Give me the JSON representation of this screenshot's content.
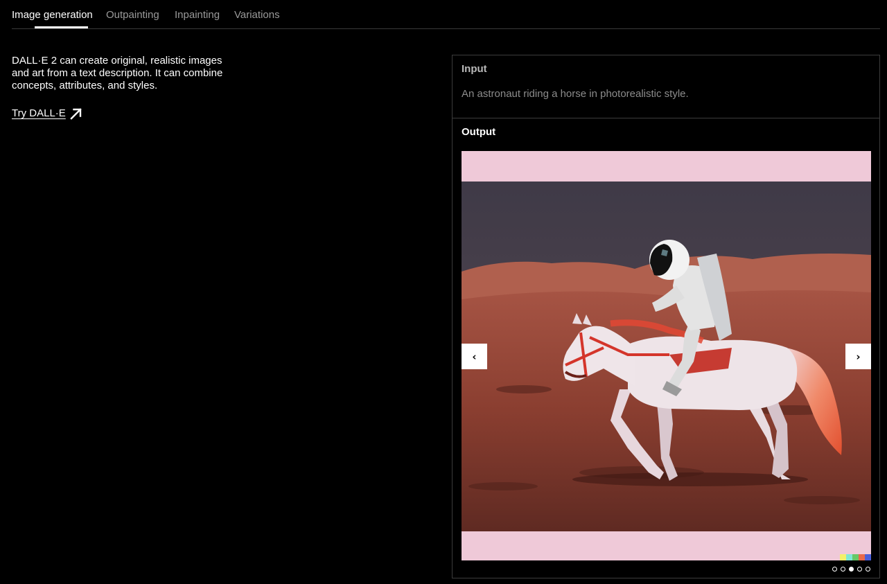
{
  "tabs": [
    {
      "label": "Image generation",
      "active": true
    },
    {
      "label": "Outpainting",
      "active": false
    },
    {
      "label": "Inpainting",
      "active": false
    },
    {
      "label": "Variations",
      "active": false
    }
  ],
  "intro": {
    "text": "DALL·E 2 can create original, realistic images and art from a text description. It can combine concepts, attributes, and styles.",
    "link_label": "Try DALL·E",
    "link_icon": "arrow-up-right-icon"
  },
  "input": {
    "title": "Input",
    "prompt": "An astronaut riding a horse in photorealistic style."
  },
  "output": {
    "title": "Output",
    "image_subject": "astronaut riding a white horse on a red desert",
    "prev_label": "‹",
    "next_label": "›",
    "carousel": {
      "count": 5,
      "active_index": 2
    }
  },
  "colors": {
    "background": "#000000",
    "active_tab": "#ffffff",
    "inactive_tab": "#9a9a9a",
    "border": "#3c3c3c",
    "image_pad": "#efc9d8",
    "watermark": [
      "#f3f06a",
      "#7ee7d4",
      "#66c866",
      "#e86a4a",
      "#4a5fd8"
    ]
  }
}
